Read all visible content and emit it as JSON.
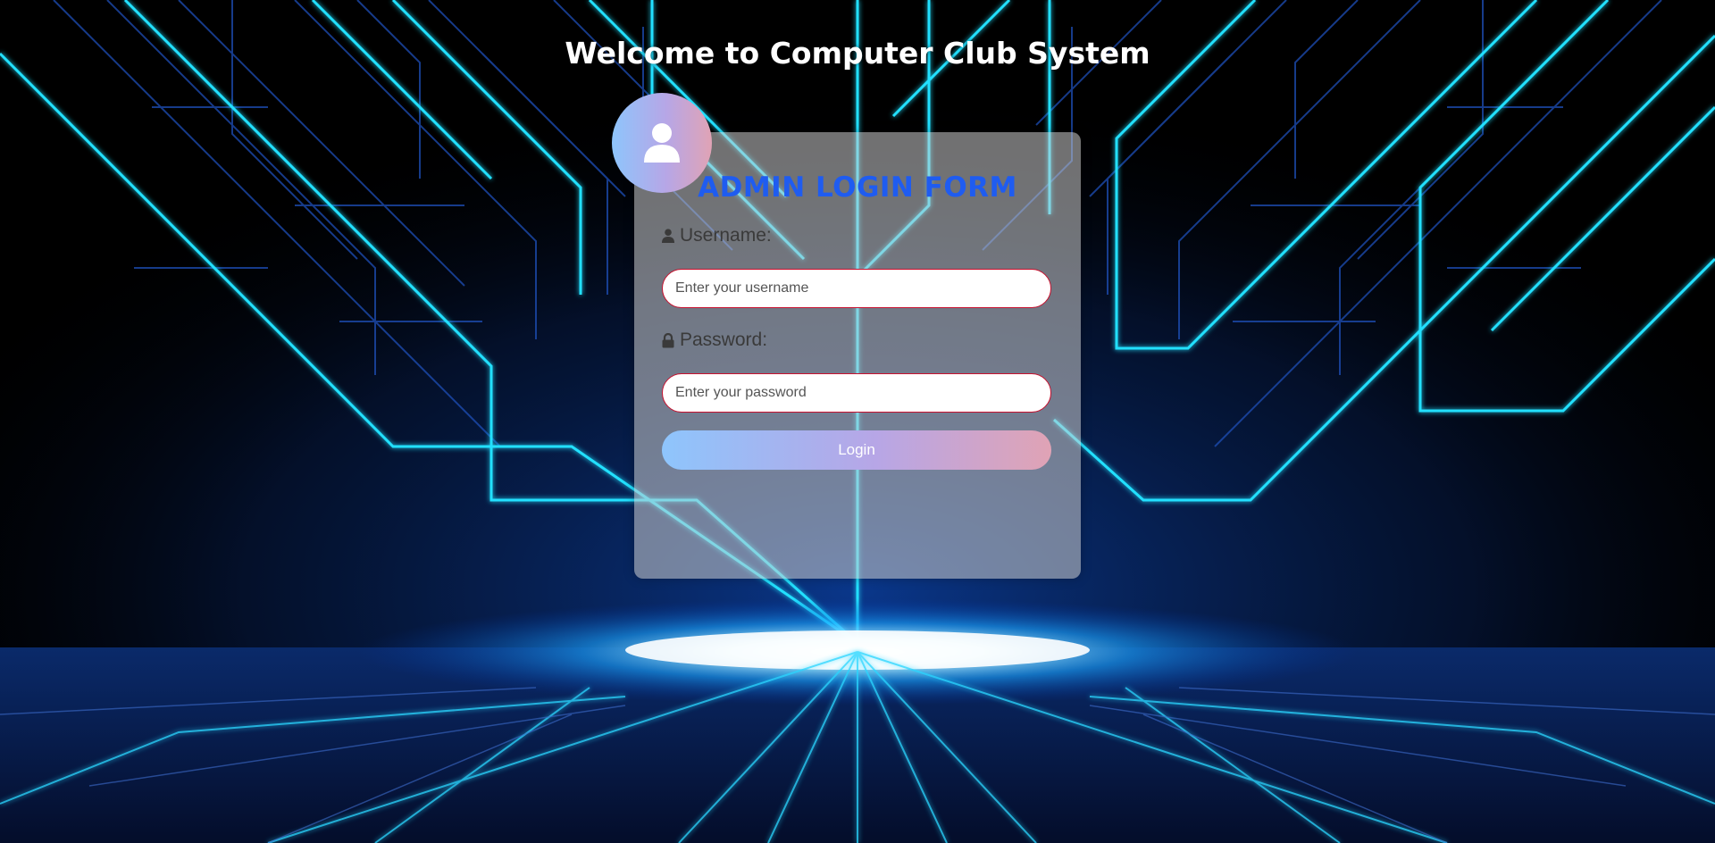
{
  "page": {
    "title": "Welcome to Computer Club System"
  },
  "form": {
    "title": "ADMIN LOGIN FORM",
    "avatar_icon": "user-icon",
    "username": {
      "label": "Username:",
      "icon": "user-icon",
      "placeholder": "Enter your username",
      "value": ""
    },
    "password": {
      "label": "Password:",
      "icon": "lock-icon",
      "placeholder": "Enter your password",
      "value": ""
    },
    "login_label": "Login"
  },
  "colors": {
    "accent_title": "#1f5cf0",
    "input_border": "#c8102e",
    "gradient_start": "#8ec5fc",
    "gradient_mid": "#b7a6e6",
    "gradient_end": "#e0a3b5",
    "circuit_glow": "#19d3ff"
  }
}
